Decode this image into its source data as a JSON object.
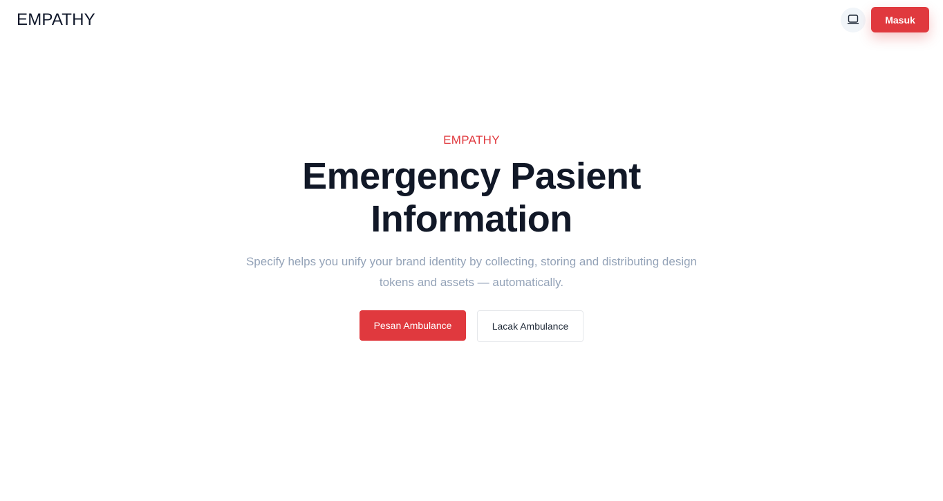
{
  "navbar": {
    "brand": "EMPATHY",
    "theme_toggle_icon": "laptop-icon",
    "login_label": "Masuk"
  },
  "hero": {
    "eyebrow": "EMPATHY",
    "headline": "Emergency Pasient Information",
    "subtitle": "Specify helps you unify your brand identity by collecting, storing and distributing design tokens and assets — automatically.",
    "primary_button": "Pesan Ambulance",
    "secondary_button": "Lacak Ambulance"
  },
  "colors": {
    "accent": "#e0393e",
    "heading": "#111827",
    "muted_text": "#94a3b8"
  }
}
